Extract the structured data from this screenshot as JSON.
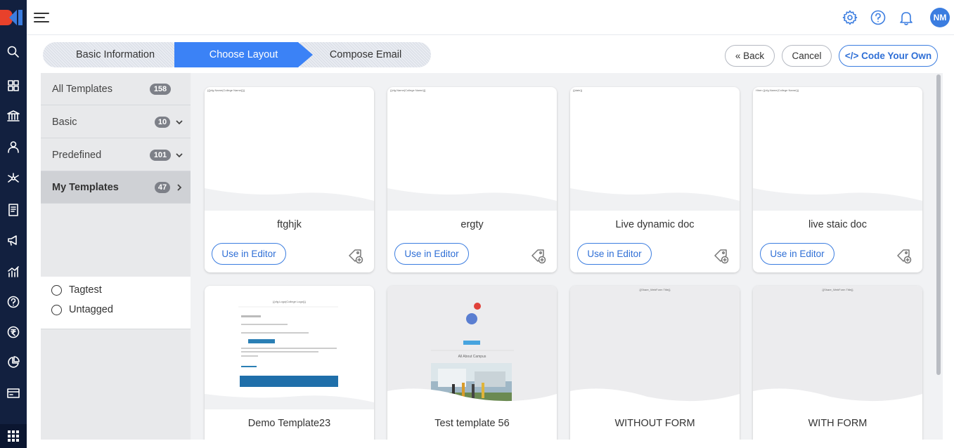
{
  "app": {
    "logo_icon": "brand-logo-icon"
  },
  "rail": {
    "icons": [
      "search-icon",
      "dashboard-icon",
      "institution-icon",
      "user-icon",
      "network-icon",
      "forms-icon",
      "campaign-icon",
      "analytics-icon",
      "help-icon",
      "rupee-icon",
      "pie-chart-icon",
      "card-icon",
      "apps-grid-icon"
    ]
  },
  "topbar": {
    "menu_icon": "hamburger-icon",
    "icons": [
      "gear-icon",
      "help-circle-icon",
      "bell-icon"
    ],
    "avatar": "NM",
    "accent": "#3b7de0"
  },
  "stepper": {
    "steps": [
      "Basic Information",
      "Choose Layout",
      "Compose Email"
    ],
    "active": 1
  },
  "actions": {
    "back": "« Back",
    "cancel": "Cancel",
    "code": "</> Code Your Own"
  },
  "filters": {
    "items": [
      {
        "label": "All Templates",
        "count": "158"
      },
      {
        "label": "Basic",
        "count": "10"
      },
      {
        "label": "Predefined",
        "count": "101"
      },
      {
        "label": "My Templates",
        "count": "47"
      }
    ],
    "tags": [
      "Tagtest",
      "Untagged"
    ]
  },
  "templates": [
    {
      "name": "ftghjk",
      "use": "Use in Editor",
      "preview_text": "{{{cfg.Name(College Name)}}}"
    },
    {
      "name": "ergty",
      "use": "Use in Editor",
      "preview_text": "{{cfg.Name(College Name)}}"
    },
    {
      "name": "Live dynamic doc",
      "use": "Use in Editor",
      "preview_text": "{{date}}"
    },
    {
      "name": "live staic doc",
      "use": "Use in Editor",
      "preview_text": "Hiren {{cfg.Name(College Name)}}"
    },
    {
      "name": "Demo Template23",
      "preview_text": "{{cfg.Logo(College Logo)}}"
    },
    {
      "name": "Test template 56",
      "preview_text": "All About Campus"
    },
    {
      "name": "WITHOUT FORM",
      "preview_text": "{{Share_WebForm Title}}"
    },
    {
      "name": "WITH FORM",
      "preview_text": "{{Share_WebForm Title}}"
    }
  ]
}
